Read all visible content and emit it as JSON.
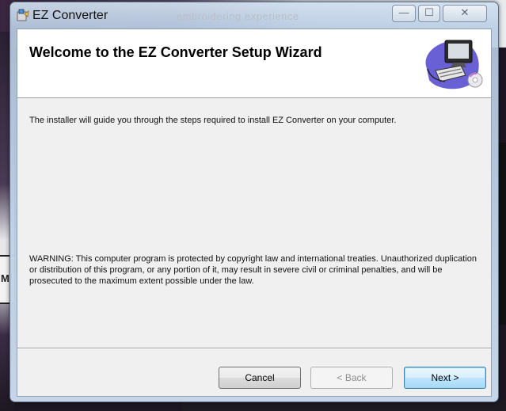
{
  "window": {
    "title": "EZ Converter",
    "background_title": "embroidering experience",
    "controls": {
      "minimize": "—",
      "maximize": "☐",
      "close": "✕"
    }
  },
  "background": {
    "left_label": "M"
  },
  "header": {
    "title": "Welcome to the EZ Converter Setup Wizard",
    "logo_icon": "computer-setup-icon"
  },
  "content": {
    "intro": "The installer will guide you through the steps required to install EZ Converter on your computer.",
    "warning": "WARNING: This computer program is protected by copyright law and international treaties. Unauthorized duplication or distribution of this program, or any portion of it, may result in severe civil or criminal penalties, and will be prosecuted to the maximum extent possible under the law."
  },
  "buttons": {
    "cancel": "Cancel",
    "back": "< Back",
    "next": "Next >"
  },
  "colors": {
    "accent": "#3c7fb1",
    "window_frame": "#b9cde4"
  }
}
